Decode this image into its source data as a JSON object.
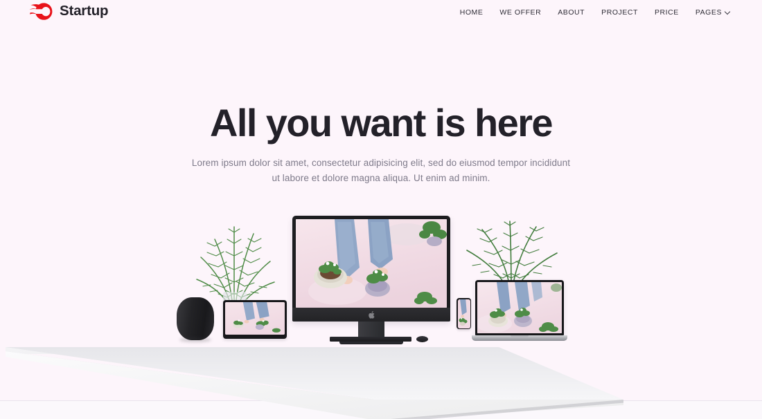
{
  "brand": {
    "name": "Startup",
    "logo_icon": "red-comet-flame-icon",
    "logo_color": "#e8131a"
  },
  "nav": {
    "items": [
      {
        "label": "HOME",
        "has_dropdown": false
      },
      {
        "label": "WE OFFER",
        "has_dropdown": false
      },
      {
        "label": "ABOUT",
        "has_dropdown": false
      },
      {
        "label": "PROJECT",
        "has_dropdown": false
      },
      {
        "label": "PRICE",
        "has_dropdown": false
      },
      {
        "label": "PAGES",
        "has_dropdown": true
      }
    ],
    "dropdown_icon": "chevron-down-icon"
  },
  "hero": {
    "title": "All you want is here",
    "subtitle_line1": "Lorem ipsum dolor sit amet, consectetur adipisicing elit, sed do eiusmod tempor incididunt",
    "subtitle_line2": "ut labore et dolore magna aliqua. Ut enim ad minim."
  },
  "scene": {
    "description": "Apple devices on a white angled desk displaying a pink planting photo",
    "devices": [
      {
        "name": "homepod-speaker"
      },
      {
        "name": "ipad-tablet"
      },
      {
        "name": "imac-desktop"
      },
      {
        "name": "keyboard"
      },
      {
        "name": "mouse"
      },
      {
        "name": "iphone"
      },
      {
        "name": "macbook-laptop"
      }
    ],
    "decor": [
      {
        "name": "fern-plant-left"
      },
      {
        "name": "fern-plant-right"
      },
      {
        "name": "glass-vase"
      }
    ]
  },
  "colors": {
    "page_background": "#fdf5fb",
    "heading": "#232129",
    "body_text": "#7e7a8a",
    "nav_text": "#2f2d37",
    "accent_red": "#e8131a",
    "screen_pink": "#f2dde6",
    "denim_blue": "#8ba2c4",
    "plant_green": "#4e8b46"
  }
}
